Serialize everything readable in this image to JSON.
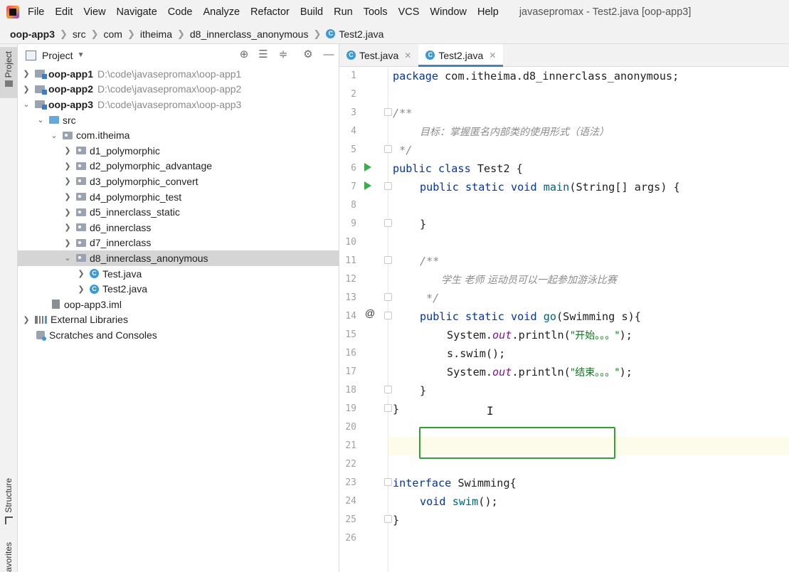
{
  "window_title": "javasepromax - Test2.java [oop-app3]",
  "menu": [
    "File",
    "Edit",
    "View",
    "Navigate",
    "Code",
    "Analyze",
    "Refactor",
    "Build",
    "Run",
    "Tools",
    "VCS",
    "Window",
    "Help"
  ],
  "breadcrumb": [
    "oop-app3",
    "src",
    "com",
    "itheima",
    "d8_innerclass_anonymous",
    "Test2.java"
  ],
  "left_stripe": {
    "project": "Project",
    "structure": "Structure",
    "favorites": "avorites"
  },
  "project_panel": {
    "title": "Project"
  },
  "tree": [
    {
      "label": "oop-app1",
      "path": "D:\\code\\javasepromax\\oop-app1"
    },
    {
      "label": "oop-app2",
      "path": "D:\\code\\javasepromax\\oop-app2"
    },
    {
      "label": "oop-app3",
      "path": "D:\\code\\javasepromax\\oop-app3"
    },
    {
      "label": "src"
    },
    {
      "label": "com.itheima"
    },
    {
      "label": "d1_polymorphic"
    },
    {
      "label": "d2_polymorphic_advantage"
    },
    {
      "label": "d3_polymorphic_convert"
    },
    {
      "label": "d4_polymorphic_test"
    },
    {
      "label": "d5_innerclass_static"
    },
    {
      "label": "d6_innerclass"
    },
    {
      "label": "d7_innerclass"
    },
    {
      "label": "d8_innerclass_anonymous"
    },
    {
      "label": "Test.java"
    },
    {
      "label": "Test2.java"
    },
    {
      "label": "oop-app3.iml"
    },
    {
      "label": "External Libraries"
    },
    {
      "label": "Scratches and Consoles"
    }
  ],
  "tabs": [
    {
      "label": "Test.java"
    },
    {
      "label": "Test2.java",
      "active": true
    }
  ],
  "code": {
    "l1": [
      "package ",
      "com.itheima.d8_innerclass_anonymous;"
    ],
    "l3": "/**",
    "l4": "目标：掌握匿名内部类的使用形式（语法）",
    "l5": " */",
    "l6": [
      "public class ",
      "Test2 {"
    ],
    "l7": [
      "public static void ",
      "main",
      "(String[] args) {"
    ],
    "l9": "}",
    "l11": "/**",
    "l12": "学生 老师 运动员可以一起参加游泳比赛",
    "l13": "*/",
    "l14": [
      "public static void ",
      "go",
      "(Swimming s){"
    ],
    "l15": [
      "System.",
      "out",
      ".println(",
      "\"开始。。。\"",
      ");"
    ],
    "l16": "s.swim();",
    "l17": [
      "System.",
      "out",
      ".println(",
      "\"结束。。。\"",
      ");"
    ],
    "l18": "}",
    "l19": "}",
    "l23": [
      "interface ",
      "Swimming{"
    ],
    "l24": [
      "void ",
      "swim",
      "();"
    ],
    "l25": "}"
  },
  "line_numbers": [
    "1",
    "2",
    "3",
    "4",
    "5",
    "6",
    "7",
    "8",
    "9",
    "10",
    "11",
    "12",
    "13",
    "14",
    "15",
    "16",
    "17",
    "18",
    "19",
    "20",
    "21",
    "22",
    "23",
    "24",
    "25",
    "26"
  ],
  "colors": {
    "keyword": "#0033b3",
    "comment": "#8c8c8c",
    "string": "#067d17",
    "method": "#00627a",
    "highlight_box": "#2fa52f"
  }
}
